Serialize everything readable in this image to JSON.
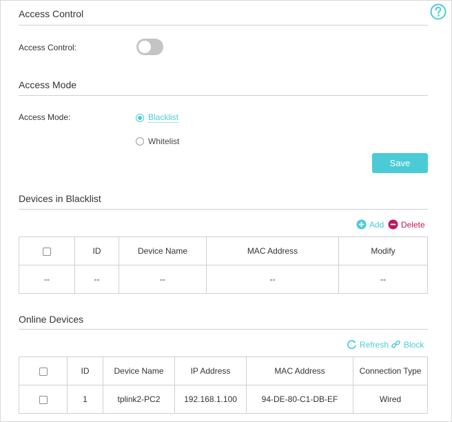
{
  "access_control": {
    "section_title": "Access Control",
    "label": "Access Control:",
    "enabled": false
  },
  "access_mode": {
    "section_title": "Access Mode",
    "label": "Access Mode:",
    "options": [
      "Blacklist",
      "Whitelist"
    ],
    "selected": "Blacklist",
    "save_label": "Save"
  },
  "blacklist": {
    "section_title": "Devices in Blacklist",
    "add_label": "Add",
    "delete_label": "Delete",
    "columns": [
      "ID",
      "Device Name",
      "MAC Address",
      "Modify"
    ],
    "rows": [
      [
        "--",
        "--",
        "--",
        "--",
        "--"
      ]
    ]
  },
  "online": {
    "section_title": "Online Devices",
    "refresh_label": "Refresh",
    "block_label": "Block",
    "columns": [
      "ID",
      "Device Name",
      "IP Address",
      "MAC Address",
      "Connection Type"
    ],
    "rows": [
      [
        "1",
        "tplink2-PC2",
        "192.168.1.100",
        "94-DE-80-C1-DB-EF",
        "Wired"
      ]
    ]
  },
  "colors": {
    "accent": "#4acbd6",
    "delete": "#c0175d",
    "toggle_off": "#c4c4c4"
  },
  "icons": {
    "help": "help-icon",
    "add": "add-icon",
    "delete": "delete-icon",
    "refresh": "refresh-icon",
    "block": "block-icon"
  }
}
